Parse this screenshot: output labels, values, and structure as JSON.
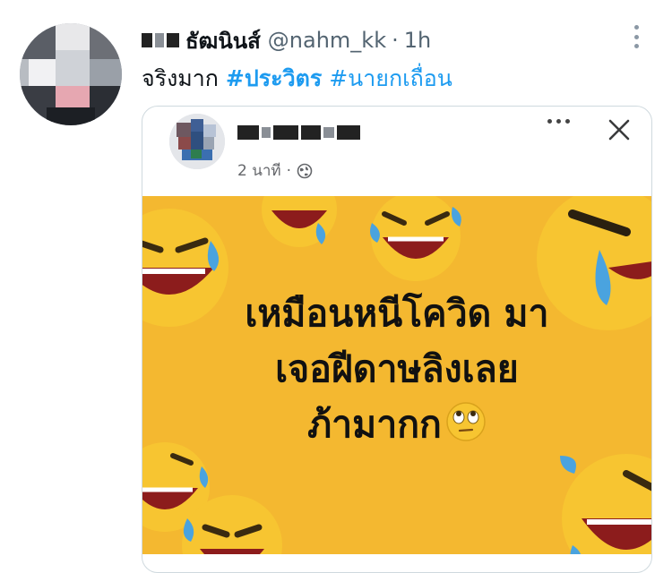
{
  "tweet": {
    "display_name_visible": "ธัฒนินส์",
    "handle": "@nahm_kk",
    "separator": "·",
    "time": "1h",
    "text_prefix": "จริงมาก ",
    "hashtags": [
      "#ประวิตร",
      "#นายกเถื่อน"
    ]
  },
  "embedded_post": {
    "time": "2 นาที",
    "separator": "·",
    "meme_lines": [
      "เหมือนหนีโควิด มา",
      "เจอฝีดาษลิงเลย",
      "ภ้ามากก"
    ]
  },
  "colors": {
    "hashtag": "#1d9bf0",
    "meme_background": "#f4b830",
    "emoji_yellow": "#f7c531"
  },
  "icons": [
    "more-options-icon",
    "fb-more-options-icon",
    "close-icon",
    "globe-icon",
    "rolling-eyes-emoji-icon",
    "laughing-crying-emoji-icon"
  ]
}
